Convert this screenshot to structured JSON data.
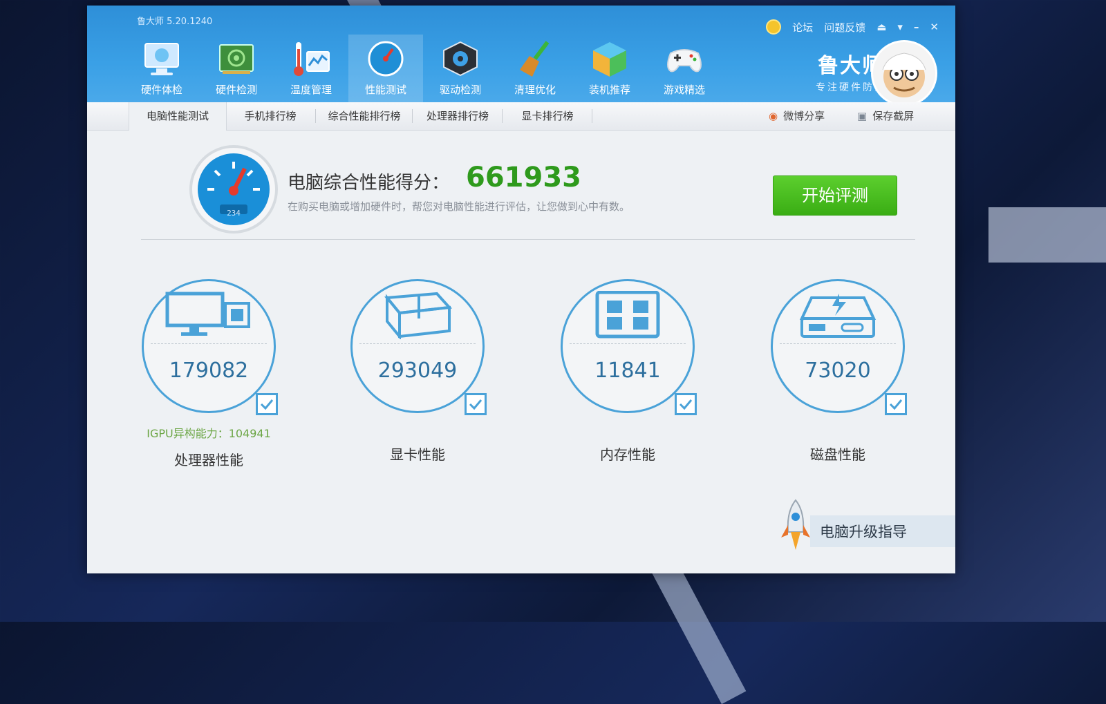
{
  "window": {
    "app_title": "鲁大师 5.20.1240"
  },
  "top_actions": {
    "forum": "论坛",
    "feedback": "问题反馈"
  },
  "nav": [
    {
      "label": "硬件体检",
      "icon": "monitor-icon",
      "active": false
    },
    {
      "label": "硬件检测",
      "icon": "circuit-board-icon",
      "active": false
    },
    {
      "label": "温度管理",
      "icon": "thermometer-icon",
      "active": false
    },
    {
      "label": "性能测试",
      "icon": "speedometer-icon",
      "active": true
    },
    {
      "label": "驱动检测",
      "icon": "gear-chip-icon",
      "active": false
    },
    {
      "label": "清理优化",
      "icon": "broom-icon",
      "active": false
    },
    {
      "label": "装机推荐",
      "icon": "cube-icon",
      "active": false
    },
    {
      "label": "游戏精选",
      "icon": "gamepad-icon",
      "active": false
    }
  ],
  "brand": {
    "name": "鲁大师",
    "slogan": "专注硬件防护"
  },
  "tabs": [
    "电脑性能测试",
    "手机排行榜",
    "综合性能排行榜",
    "处理器排行榜",
    "显卡排行榜"
  ],
  "share": {
    "weibo": "微博分享",
    "screenshot": "保存截屏"
  },
  "score": {
    "title": "电脑综合性能得分：",
    "value": "661933",
    "description": "在购买电脑或增加硬件时，帮您对电脑性能进行评估，让您做到心中有数。",
    "gauge_reading": "234",
    "start_button": "开始评测"
  },
  "metrics": [
    {
      "value": "179082",
      "label": "处理器性能",
      "extra": "IGPU异构能力：104941",
      "icon": "cpu-monitor-icon"
    },
    {
      "value": "293049",
      "label": "显卡性能",
      "extra": "",
      "icon": "graphics-card-icon"
    },
    {
      "value": "11841",
      "label": "内存性能",
      "extra": "",
      "icon": "memory-icon"
    },
    {
      "value": "73020",
      "label": "磁盘性能",
      "extra": "",
      "icon": "disk-icon"
    }
  ],
  "upgrade": {
    "label": "电脑升级指导"
  },
  "colors": {
    "header": "#3aa0e6",
    "score_green": "#2e9a1c",
    "button_green": "#4cbf22",
    "ring_blue": "#4aa2d8"
  }
}
